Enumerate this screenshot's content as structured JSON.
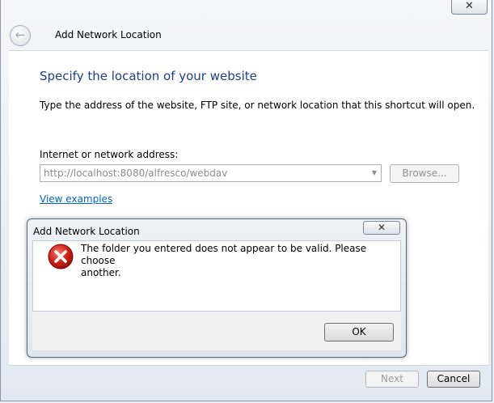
{
  "window": {
    "title": "Add Network Location",
    "close_glyph": "✕",
    "back_glyph": "←"
  },
  "page": {
    "heading": "Specify the location of your website",
    "instructions": "Type the address of the website, FTP site, or network location that this shortcut will open.",
    "address_label": "Internet or network address:",
    "address_value": "http://localhost:8080/alfresco/webdav",
    "dropdown_glyph": "▼",
    "browse_label": "Browse...",
    "examples_link": "View examples"
  },
  "footer": {
    "next_label": "Next",
    "cancel_label": "Cancel"
  },
  "dialog": {
    "title": "Add Network Location",
    "close_glyph": "✕",
    "icon": "error-icon",
    "message_line1": "The folder you entered does not appear to be valid.  Please choose",
    "message_line2": "another.",
    "ok_label": "OK"
  }
}
